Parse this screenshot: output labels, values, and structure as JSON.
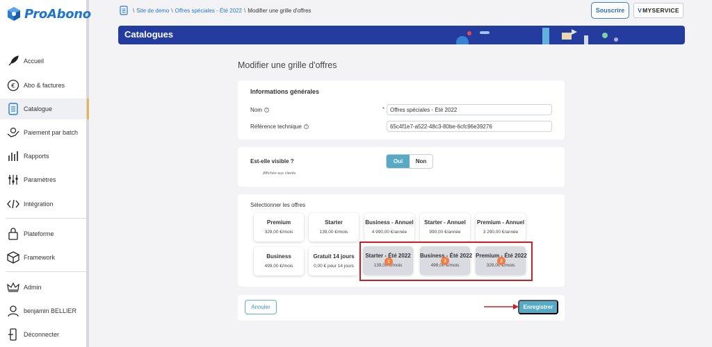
{
  "brand": {
    "name": "ProAbono"
  },
  "sidebar": {
    "items": [
      {
        "label": "Accueil",
        "icon": "rocket-icon"
      },
      {
        "label": "Abo & factures",
        "icon": "euro-icon"
      },
      {
        "label": "Catalogue",
        "icon": "catalog-icon"
      },
      {
        "label": "Paiement par batch",
        "icon": "payment-batch-icon"
      },
      {
        "label": "Rapports",
        "icon": "reports-icon"
      },
      {
        "label": "Paramètres",
        "icon": "settings-sliders-icon"
      },
      {
        "label": "Intégration",
        "icon": "code-icon"
      },
      {
        "label": "Plateforme",
        "icon": "platform-icon"
      },
      {
        "label": "Framework",
        "icon": "cube-icon"
      },
      {
        "label": "Admin",
        "icon": "crown-icon"
      },
      {
        "label": "benjamin BELLIER",
        "icon": "user-icon"
      },
      {
        "label": "Déconnecter",
        "icon": "logout-icon"
      }
    ]
  },
  "breadcrumb": {
    "items": [
      "Site de demo",
      "Offres spéciales - Été 2022"
    ],
    "current": "Modifier une grille d'offres",
    "separator": "\\"
  },
  "header": {
    "subscribe_label": "Souscrire",
    "myservice_v": "V",
    "myservice_text": "MYSERVICE"
  },
  "banner": {
    "title": "Catalogues"
  },
  "main": {
    "title": "Modifier une grille d'offres",
    "general": {
      "title": "Informations générales",
      "name_label": "Nom",
      "name_required": "*",
      "name_value": "Offres spéciales - Été 2022",
      "ref_label": "Référence technique",
      "ref_value": "65c4f1e7-a522-48c3-80be-6cfc96e39276",
      "help_glyph": "?"
    },
    "visibility": {
      "title": "Est-elle visible ?",
      "subtitle": "Affichée aux clients",
      "yes": "Oui",
      "no": "Non",
      "selected": "Oui"
    },
    "offers": {
      "title": "Sélectionner les offres",
      "row1": [
        {
          "name": "Premium",
          "price": "329,00 €/mois"
        },
        {
          "name": "Starter",
          "price": "139,00 €/mois"
        },
        {
          "name": "Business - Annuel",
          "price": "4 990,00 €/année"
        },
        {
          "name": "Starter - Annuel",
          "price": "990,00 €/année"
        },
        {
          "name": "Premium - Annuel",
          "price": "3 290,00 €/année"
        }
      ],
      "row2": [
        {
          "name": "Business",
          "price": "499,00 €/mois",
          "selected": false
        },
        {
          "name": "Gratuit 14 jours",
          "price": "0,00 € pour 14 jours",
          "selected": false
        },
        {
          "name": "Starter - Été 2022",
          "price": "139,00 €/mois",
          "selected": true,
          "order": "1"
        },
        {
          "name": "Business - Été 2022",
          "price": "499,00 €/mois",
          "selected": true,
          "order": "3"
        },
        {
          "name": "Premium - Été 2022",
          "price": "329,00 €/mois",
          "selected": true,
          "order": "2"
        }
      ]
    },
    "actions": {
      "cancel": "Annuler",
      "save": "Enregistrer"
    }
  },
  "colors": {
    "brand_blue": "#1f76c9",
    "banner": "#243c9e",
    "accent": "#56aac6",
    "badge": "#f07d43",
    "highlight": "#c92027"
  }
}
